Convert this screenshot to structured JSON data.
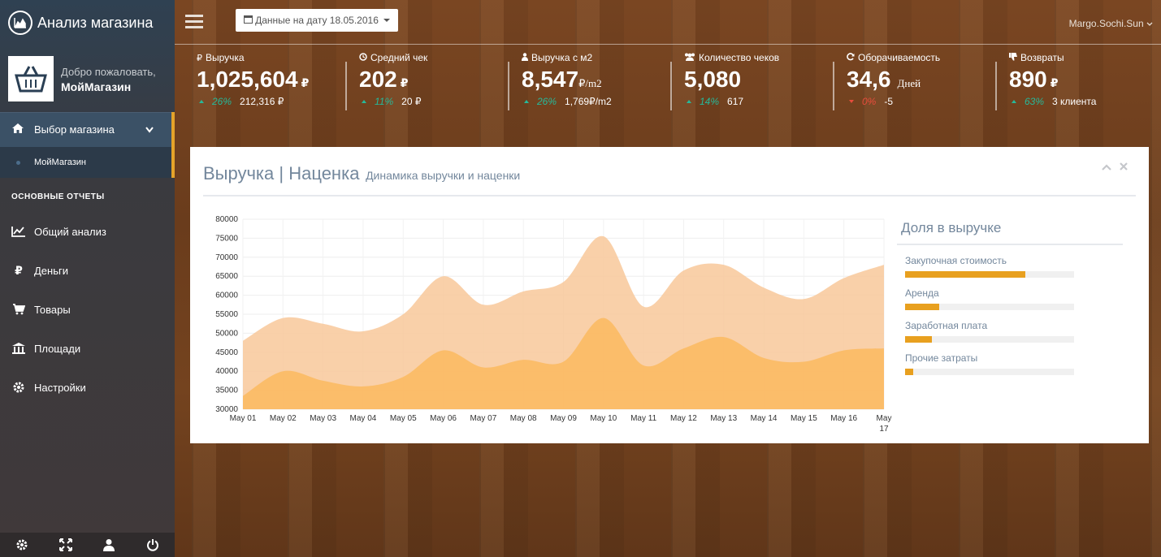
{
  "app": {
    "title": "Анализ магазина"
  },
  "profile": {
    "welcome": "Добро пожаловать,",
    "name": "МойМагазин"
  },
  "sidebar": {
    "active": {
      "label": "Выбор магазина"
    },
    "sub": {
      "label": "МойМагазин"
    },
    "section": "ОСНОВНЫЕ ОТЧЕТЫ",
    "items": [
      {
        "label": "Общий анализ",
        "icon": "line-chart-icon"
      },
      {
        "label": "Деньги",
        "icon": "ruble-icon"
      },
      {
        "label": "Товары",
        "icon": "cart-icon"
      },
      {
        "label": "Площади",
        "icon": "bank-icon"
      },
      {
        "label": "Настройки",
        "icon": "gear-icon"
      }
    ]
  },
  "topnav": {
    "date_label": "Данные на дату 18.05.2016",
    "user": "Margo.Sochi.Sun"
  },
  "tiles": [
    {
      "title": "Выручка",
      "value": "1,025,604",
      "unit": "₽",
      "pct": "26%",
      "dir": "up",
      "extra": "212,316 ₽"
    },
    {
      "title": "Средний чек",
      "value": "202",
      "unit": "₽",
      "pct": "11%",
      "dir": "up",
      "extra": "20 ₽"
    },
    {
      "title": "Выручка с м2",
      "value": "8,547",
      "unit": "₽/m2",
      "pct": "26%",
      "dir": "up",
      "extra": "1,769₽/m2"
    },
    {
      "title": "Количество чеков",
      "value": "5,080",
      "unit": "",
      "pct": "14%",
      "dir": "up",
      "extra": "617"
    },
    {
      "title": "Оборачиваемость",
      "value": "34,6",
      "unit": "Дней",
      "pct": "0%",
      "dir": "down",
      "extra": "-5"
    },
    {
      "title": "Возвраты",
      "value": "890",
      "unit": "₽",
      "pct": "63%",
      "dir": "up",
      "extra": "3 клиента"
    }
  ],
  "panel": {
    "title": "Выручка | Наценка",
    "subtitle": "Динамика выручки и наценки"
  },
  "share": {
    "title": "Доля в выручке",
    "rows": [
      {
        "label": "Закупочная стоимость",
        "value": 0.71
      },
      {
        "label": "Аренда",
        "value": 0.2
      },
      {
        "label": "Заработная плата",
        "value": 0.16
      },
      {
        "label": "Прочие затраты",
        "value": 0.05
      }
    ]
  },
  "chart_data": {
    "type": "area",
    "categories": [
      "May 01",
      "May 02",
      "May 03",
      "May 04",
      "May 05",
      "May 06",
      "May 07",
      "May 08",
      "May 09",
      "May 10",
      "May 11",
      "May 12",
      "May 13",
      "May 14",
      "May 15",
      "May 16",
      "May 17"
    ],
    "ylim": [
      30000,
      80000
    ],
    "yticks": [
      30000,
      35000,
      40000,
      45000,
      50000,
      55000,
      60000,
      65000,
      70000,
      75000,
      80000
    ],
    "series": [
      {
        "values": [
          48000,
          54000,
          52500,
          50500,
          55000,
          65000,
          57500,
          61000,
          63500,
          75500,
          57000,
          66500,
          68000,
          62000,
          59000,
          64500,
          68000
        ],
        "color": "#f8c89a"
      },
      {
        "values": [
          33500,
          40000,
          37500,
          36000,
          38500,
          45500,
          41000,
          43000,
          42500,
          54000,
          41500,
          46000,
          49000,
          43500,
          42500,
          45500,
          46000
        ],
        "color": "#fbb85a"
      }
    ]
  },
  "icons": {
    "brand": "area-chart-icon",
    "hamburger": "bars-icon",
    "calendar": "calendar-icon"
  }
}
